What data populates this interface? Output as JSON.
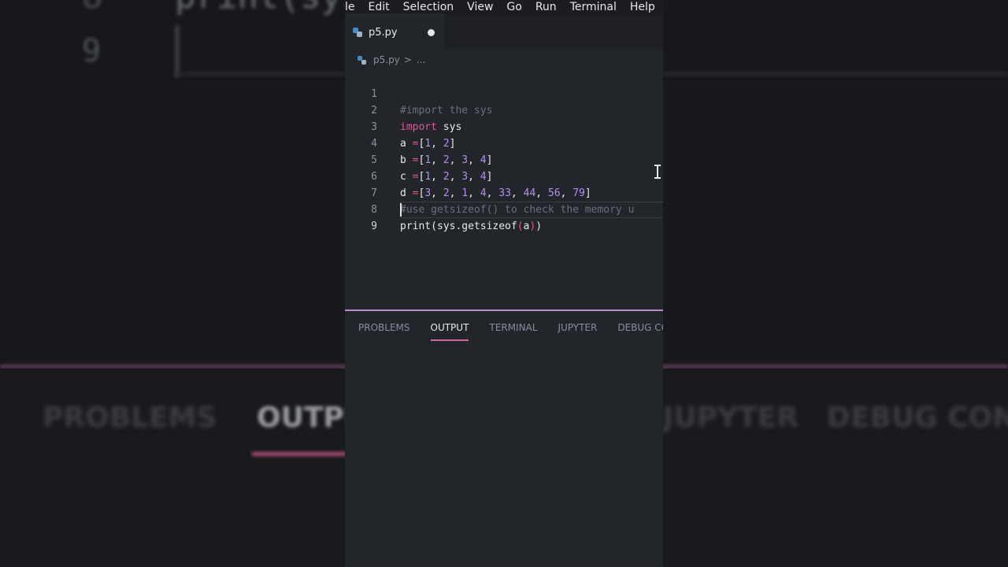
{
  "menu": [
    "le",
    "Edit",
    "Selection",
    "View",
    "Go",
    "Run",
    "Terminal",
    "Help"
  ],
  "tab": {
    "filename": "p5.py"
  },
  "breadcrumb": {
    "file": "p5.py",
    "separator": ">",
    "more": "..."
  },
  "editor": {
    "line_numbers": [
      "1",
      "2",
      "3",
      "4",
      "5",
      "6",
      "7",
      "8",
      "9"
    ],
    "lines": {
      "l1": {
        "comment": "#import the sys"
      },
      "l2": {
        "kw": "import",
        "rest": " sys"
      },
      "l3": {
        "var": "a ",
        "op": "=",
        "open": "[",
        "n1": "1",
        "n2": "2",
        "close": "]"
      },
      "l4": {
        "var": "b ",
        "op": "=",
        "open": "[",
        "nums": [
          "1",
          "2",
          "3",
          "4"
        ],
        "close": "]"
      },
      "l5": {
        "var": "c ",
        "op": "=",
        "open": "[",
        "nums": [
          "1",
          "2",
          "3",
          "4"
        ],
        "close": "]"
      },
      "l6": {
        "var": "d ",
        "op": "=",
        "open": "[",
        "nums": [
          "3",
          "2",
          "1",
          "4",
          "33",
          "44",
          "56",
          "79"
        ],
        "close": "]"
      },
      "l7": {
        "comment": "#use getsizeof() to check the memory u"
      },
      "l8": {
        "pre": "print(sys.getsizeof",
        "open": "(",
        "arg": "a",
        "close": ")",
        "end": ")"
      }
    }
  },
  "panel": {
    "tabs": [
      "PROBLEMS",
      "OUTPUT",
      "TERMINAL",
      "JUPYTER",
      "DEBUG CONS"
    ]
  },
  "background": {
    "code_fragment": "print(sys",
    "line8": "8",
    "line9": "9",
    "tabs": [
      "PROBLEMS",
      "OUTPU",
      "JUPYTER",
      "DEBUG CONS"
    ]
  },
  "colors": {
    "keyword": "#e3559a",
    "number": "#b38df0",
    "comment": "#6a6f7a",
    "panel_accent": "#b68bd0"
  }
}
